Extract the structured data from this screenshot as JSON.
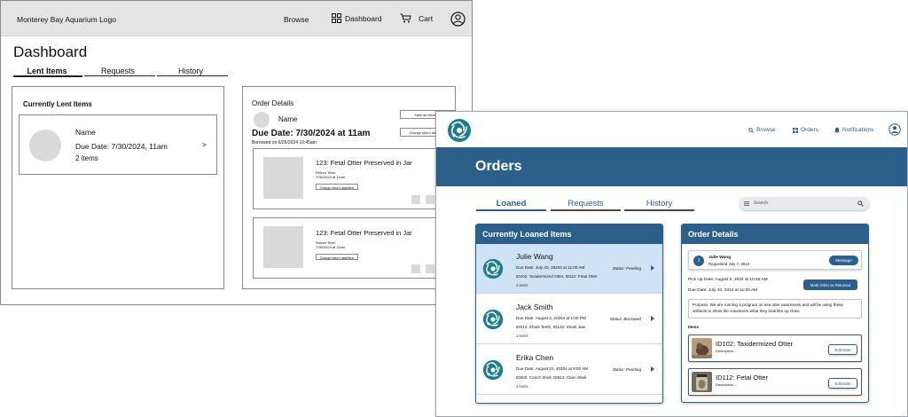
{
  "wireframe": {
    "logo_text": "Monterey Bay Aquarium Logo",
    "nav": {
      "browse": "Browse",
      "dashboard": "Dashboard",
      "cart": "Cart"
    },
    "page_title": "Dashboard",
    "tabs": [
      "Lent Items",
      "Requests",
      "History"
    ],
    "current_lent": {
      "title": "Currently Lent Items",
      "card": {
        "name": "Name",
        "due": "Due Date: 7/30/2024, 11am",
        "items": "2 items",
        "chevron": ">"
      }
    },
    "order_details": {
      "title": "Order Details",
      "name": "Name",
      "btn_mark_returned": "Mark as returned",
      "btn_change_return": "Change return date/time",
      "due_date": "Due Date: 7/30/2024 at 11am",
      "borrowed_on": "Borrowed on 6/26/2024 10:45am",
      "items": [
        {
          "title": "123: Fetal Otter Preserved in Jar",
          "return_label": "Return Time:",
          "return_value": "7/30/2024 at 11am",
          "button": "Change return date/time"
        },
        {
          "title": "123: Fetal Otter Preserved in Jar",
          "return_label": "Return Time:",
          "return_value": "7/30/2024 at 11am",
          "button": "Change return date/time"
        }
      ]
    }
  },
  "hifi": {
    "nav": {
      "browse": "Browse",
      "orders": "Orders",
      "notifications": "Notifications"
    },
    "page_title": "Orders",
    "tabs": [
      "Loaned",
      "Requests",
      "History"
    ],
    "search_placeholder": "Search",
    "loaned_panel": {
      "title": "Currently Loaned Items",
      "rows": [
        {
          "name": "Julie Wang",
          "due": "Due Date: July 30, 20204 at 11:00 AM",
          "items": "ID102: Taxidermized Otter, ID112: Fetal Otter",
          "count": "2 items",
          "status": "Status: Pending"
        },
        {
          "name": "Jack Smith",
          "due": "Due Date: August 3, 20204 at 1:00 PM",
          "items": "ID012: Shark Teeth, ID132: Shark Jaw",
          "count": "1 items",
          "status": "Status: Borrowed"
        },
        {
          "name": "Erika Chen",
          "due": "Due Date: August 10, 20204 at 9:00 AM",
          "items": "ID902: Conch Shell, ID912: Clam Shell",
          "count": "4 items",
          "status": "Status: Pending"
        }
      ]
    },
    "order_panel": {
      "title": "Order Details",
      "requester_initial": "J",
      "requester_name": "Julie Wang",
      "requested_on": "Requested July 7, 2024",
      "message_button": "Message",
      "pickup": "Pick Up Date: August 6, 2024 at 10:45 AM",
      "due": "Due Date: July 30, 2024 at 11:00 AM",
      "mark_returned_button": "Mark Order as Returned",
      "purpose": "Purpose: We are running a program on sea otter awareness and will be using these artifacts to show the volunteers what they look like up close.",
      "items_label": "Items",
      "items": [
        {
          "name": "ID102: Taxidermized Otter",
          "desc": "Description...",
          "button": "Edit Date"
        },
        {
          "name": "ID112: Fetal Otter",
          "desc": "Description...",
          "button": "Edit Date"
        }
      ]
    },
    "colors": {
      "primary": "#2c5f8a",
      "selected_row": "#cfe3f7",
      "logo_teal": "#1d7c8f"
    }
  }
}
